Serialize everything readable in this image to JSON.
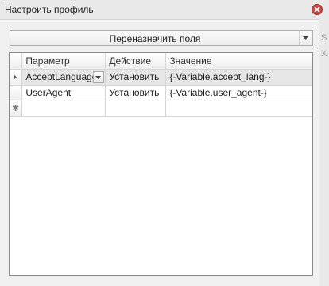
{
  "window": {
    "title": "Настроить профиль"
  },
  "remap_button": {
    "label": "Переназначить поля"
  },
  "grid": {
    "headers": {
      "param": "Параметр",
      "action": "Действие",
      "value": "Значение"
    },
    "rows": [
      {
        "param": "AcceptLanguage",
        "action": "Установить",
        "value": "{-Variable.accept_lang-}"
      },
      {
        "param": "UserAgent",
        "action": "Установить",
        "value": "{-Variable.user_agent-}"
      }
    ]
  },
  "side_fragments": {
    "a": "S",
    "b": "X"
  },
  "colors": {
    "close_button": "#c94744",
    "selected_row": "#e6e6e6"
  }
}
